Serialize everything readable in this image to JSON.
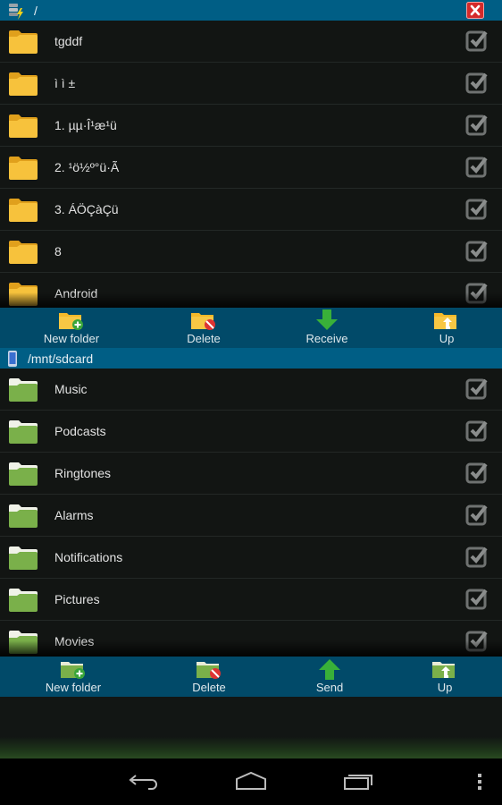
{
  "top_panel": {
    "path": "/",
    "storage_icon": "root-storage-icon",
    "close_icon": "close-icon",
    "items": [
      {
        "name": "tgddf",
        "checked": false
      },
      {
        "name": "ì   ì ±",
        "checked": false
      },
      {
        "name": "1. µµ·Î¹æ¹ü",
        "checked": false
      },
      {
        "name": "2. ¹ö½º°ü·Ã",
        "checked": false
      },
      {
        "name": "3. ÁÖÇàÇü",
        "checked": false
      },
      {
        "name": "8",
        "checked": false
      },
      {
        "name": "Android",
        "checked": false
      }
    ],
    "folder_color": "#f5b92a",
    "toolbar": {
      "new_folder": "New folder",
      "delete": "Delete",
      "transfer": "Receive",
      "up": "Up"
    }
  },
  "bottom_panel": {
    "path": "/mnt/sdcard",
    "storage_icon": "phone-storage-icon",
    "items": [
      {
        "name": "Music",
        "checked": false
      },
      {
        "name": "Podcasts",
        "checked": false
      },
      {
        "name": "Ringtones",
        "checked": false
      },
      {
        "name": "Alarms",
        "checked": false
      },
      {
        "name": "Notifications",
        "checked": false
      },
      {
        "name": "Pictures",
        "checked": false
      },
      {
        "name": "Movies",
        "checked": false
      }
    ],
    "folder_color": "#7ab04a",
    "toolbar": {
      "new_folder": "New folder",
      "delete": "Delete",
      "transfer": "Send",
      "up": "Up"
    }
  },
  "navigation": {
    "back": "back-icon",
    "home": "home-icon",
    "recents": "recent-apps-icon",
    "menu": "overflow-menu-icon"
  },
  "colors": {
    "path_bar": "#005e85",
    "toolbar": "#014a69",
    "background": "#121513"
  }
}
